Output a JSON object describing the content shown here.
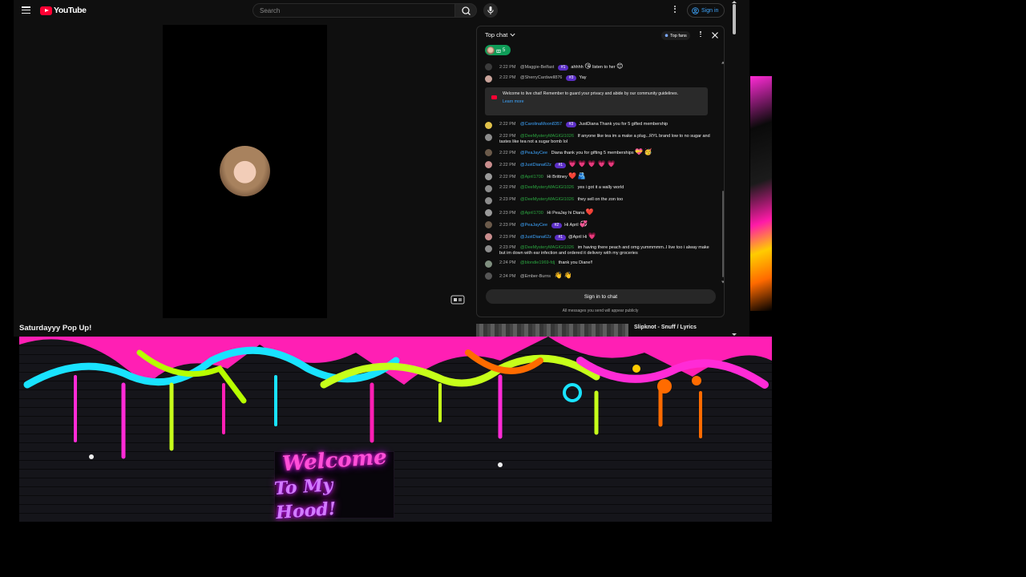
{
  "masthead": {
    "logo_text": "YouTube",
    "search_placeholder": "Search",
    "sign_in_label": "Sign in"
  },
  "video": {
    "title": "Saturdayyy Pop Up!"
  },
  "chat": {
    "mode_label": "Top chat",
    "top_fans_label": "Top fans",
    "ticker_count": "5",
    "welcome": {
      "text": "Welcome to live chat! Remember to guard your privacy and abide by our community guidelines.",
      "link": "Learn more"
    },
    "messages_before": [
      {
        "time": "2:22 PM",
        "author": "@Maggie-Belfast",
        "author_style": "plain",
        "badge": "#1",
        "text": "ahhhh",
        "emoji": "😘",
        "text2": "listen to her",
        "emoji2": "😊",
        "avatar_color": "#3b3b3b"
      },
      {
        "time": "2:22 PM",
        "author": "@SherryCardwell876",
        "author_style": "plain",
        "badge": "#3",
        "text": "Yay",
        "emoji": "",
        "text2": "",
        "emoji2": "",
        "avatar_color": "#c9a39a"
      }
    ],
    "messages_after": [
      {
        "time": "2:22 PM",
        "author": "@CarolinaMoon8357",
        "author_style": "blue",
        "badge": "#3",
        "text": "JustDiana Thank you for 5 gifted membership",
        "emoji": "",
        "text2": "",
        "emoji2": "",
        "avatar_color": "#e1c24a"
      },
      {
        "time": "2:22 PM",
        "author": "@DeeMysteryMAGIGI1026",
        "author_style": "member",
        "badge": "",
        "text": "If anyone like tea im a make a plug...RYL brand low to no sugar and tastes like tea not a sugar bomb lol",
        "emoji": "",
        "text2": "",
        "emoji2": "",
        "avatar_color": "#8c8c8c"
      },
      {
        "time": "2:22 PM",
        "author": "@PeaJayCee",
        "author_style": "blue",
        "badge": "",
        "text": "Diana thank you for gifting 5 memberships",
        "emoji": "💝",
        "text2": "",
        "emoji2": "🥳",
        "avatar_color": "#6b5a4a"
      },
      {
        "time": "2:22 PM",
        "author": "@JustDiana62z",
        "author_style": "blue",
        "badge": "#1",
        "text": "",
        "emoji": "💗 💗 💗 💗 💗",
        "text2": "",
        "emoji2": "",
        "avatar_color": "#c98d8d"
      },
      {
        "time": "2:22 PM",
        "author": "@April1700",
        "author_style": "member",
        "badge": "",
        "text": "Hi Brittney",
        "emoji": "❤️",
        "text2": "",
        "emoji2": "🫂",
        "avatar_color": "#9a9a9a"
      },
      {
        "time": "2:22 PM",
        "author": "@DeeMysteryMAGIGI1026",
        "author_style": "member",
        "badge": "",
        "text": "yes i got it a wally world",
        "emoji": "",
        "text2": "",
        "emoji2": "",
        "avatar_color": "#8c8c8c"
      },
      {
        "time": "2:23 PM",
        "author": "@DeeMysteryMAGIGI1026",
        "author_style": "member",
        "badge": "",
        "text": "they sell on the zon too",
        "emoji": "",
        "text2": "",
        "emoji2": "",
        "avatar_color": "#8c8c8c"
      },
      {
        "time": "2:23 PM",
        "author": "@April1700",
        "author_style": "member",
        "badge": "",
        "text": "Hi PeaJay hi Diana",
        "emoji": "❤️",
        "text2": "",
        "emoji2": "",
        "avatar_color": "#9a9a9a"
      },
      {
        "time": "2:23 PM",
        "author": "@PeaJayCee",
        "author_style": "blue",
        "badge": "#2",
        "text": "Hi April",
        "emoji": "💞",
        "text2": "",
        "emoji2": "",
        "avatar_color": "#6b5a4a"
      },
      {
        "time": "2:23 PM",
        "author": "@JustDiana62z",
        "author_style": "blue",
        "badge": "#1",
        "text": "@April Hi",
        "emoji": "💗",
        "text2": "",
        "emoji2": "",
        "avatar_color": "#c98d8d"
      },
      {
        "time": "2:23 PM",
        "author": "@DeeMysteryMAGIGI1026",
        "author_style": "member",
        "badge": "",
        "text": "im having there peach and omg yummmmm..I live too i alway make but im down with ear infection and ordered it delivery with my groceries",
        "emoji": "",
        "text2": "",
        "emoji2": "",
        "avatar_color": "#8c8c8c"
      },
      {
        "time": "2:24 PM",
        "author": "@blondie1969-fdj",
        "author_style": "member",
        "badge": "",
        "text": "thank you Diane!!",
        "emoji": "",
        "text2": "",
        "emoji2": "",
        "avatar_color": "#7f8f7f"
      },
      {
        "time": "2:24 PM",
        "author": "@Ember-Burns",
        "author_style": "plain",
        "badge": "",
        "text": "",
        "emoji": "👋 👋",
        "text2": "",
        "emoji2": "",
        "avatar_color": "#555"
      }
    ],
    "sign_in_chat_label": "Sign in to chat",
    "publicly_note": "All messages you send will appear publicly"
  },
  "up_next": {
    "title": "Slipknot - Snuff / Lyrics"
  },
  "wallpaper": {
    "sign_line1": "Welcome",
    "sign_line2": "To My Hood!"
  },
  "colors": {
    "accent_red": "#ff0033",
    "link_blue": "#3ea6ff",
    "member_green": "#2ba640",
    "badge_purple": "#5b2ec5"
  }
}
